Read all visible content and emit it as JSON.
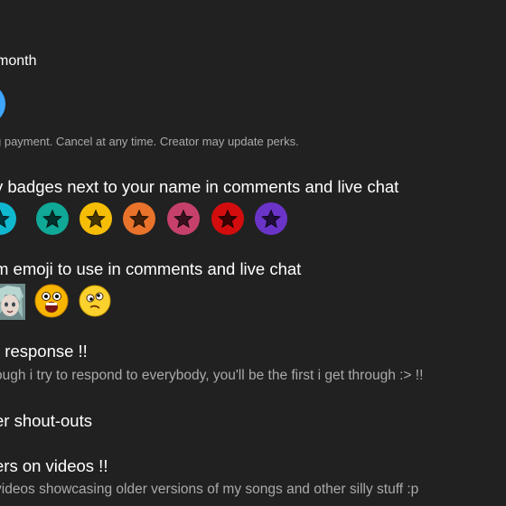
{
  "membership": {
    "price_text": "month",
    "disclaimer": "g payment. Cancel at any time. Creator may update perks."
  },
  "perks": [
    {
      "title": "y badges next to your name in comments and live chat",
      "badges": [
        {
          "color": "#0fb8cf",
          "icon": "star-icon"
        },
        {
          "color": "#10a896",
          "icon": "star-icon"
        },
        {
          "color": "#f5bd05",
          "icon": "star-icon"
        },
        {
          "color": "#e9732a",
          "icon": "star-icon"
        },
        {
          "color": "#c5416b",
          "icon": "star-icon"
        },
        {
          "color": "#d30d0d",
          "icon": "star-icon"
        },
        {
          "color": "#6b34c8",
          "icon": "star-icon"
        }
      ]
    },
    {
      "title": "m emoji to use in comments and live chat",
      "emojis": [
        "anime-character-emoji",
        "surprised-face-emoji",
        "dizzy-face-emoji"
      ]
    },
    {
      "title": "r response !!",
      "description": "ough i try to respond to everybody, you'll be the first i get through :> !!"
    },
    {
      "title": "er shout-outs"
    },
    {
      "title": "ers on videos !!",
      "description": "videos showcasing older versions of my songs and other silly stuff :p"
    }
  ]
}
